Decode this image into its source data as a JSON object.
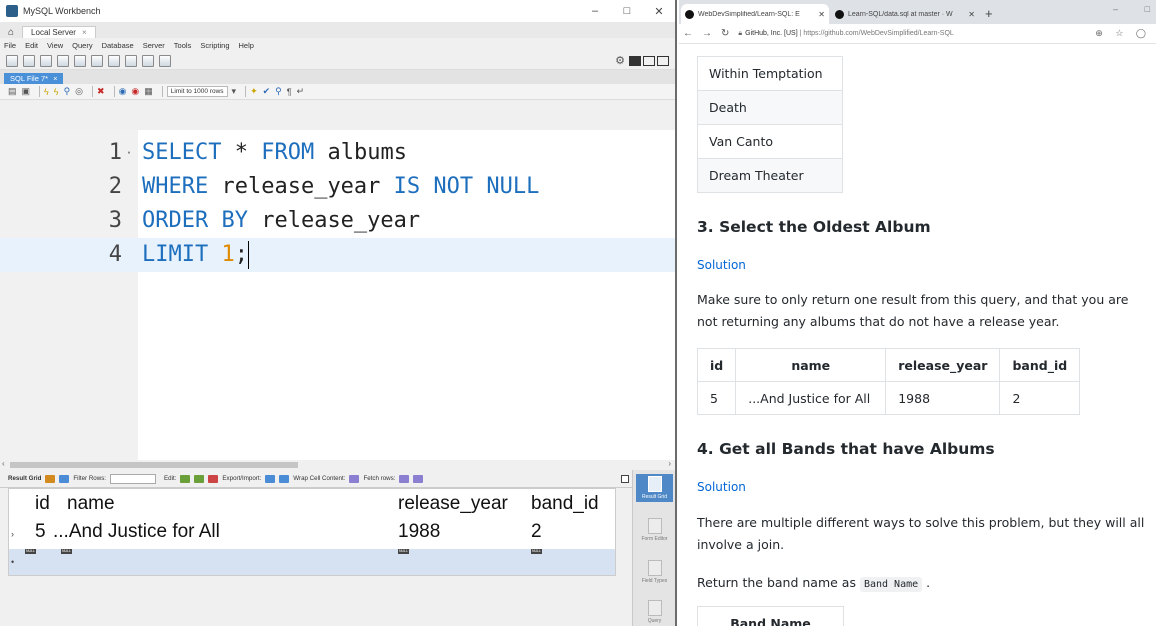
{
  "workbench": {
    "title": "MySQL Workbench",
    "window_controls": [
      "–",
      "□",
      "✕"
    ],
    "connection_tab": "Local Server",
    "menu": [
      "File",
      "Edit",
      "View",
      "Query",
      "Database",
      "Server",
      "Tools",
      "Scripting",
      "Help"
    ],
    "sql_tab": "SQL File 7*",
    "limit_select": "Limit to 1000 rows",
    "code_lines": [
      {
        "num": "1",
        "fold": "·"
      },
      {
        "num": "2",
        "fold": ""
      },
      {
        "num": "3",
        "fold": ""
      },
      {
        "num": "4",
        "fold": ""
      }
    ],
    "code_tokens": {
      "l1_kw1": "SELECT",
      "l1_mid": " * ",
      "l1_kw2": "FROM",
      "l1_rest": " albums",
      "l2_kw1": "WHERE",
      "l2_mid": " release_year ",
      "l2_kw2": "IS NOT NULL",
      "l3_kw1": "ORDER BY",
      "l3_rest": " release_year",
      "l4_kw1": "LIMIT",
      "l4_num": "1",
      "l4_end": ";"
    },
    "result_toolbar": {
      "result_grid": "Result Grid",
      "filter_rows": "Filter Rows:",
      "edit": "Edit:",
      "export_import": "Export/Import:",
      "wrap": "Wrap Cell Content:",
      "fetch_rows": "Fetch rows:"
    },
    "grid": {
      "columns": [
        "id",
        "name",
        "release_year",
        "band_id"
      ],
      "rows": [
        [
          "5",
          "...And Justice for All",
          "1988",
          "2"
        ]
      ],
      "null_label": "NULL"
    },
    "side_panel": [
      "Result Grid",
      "Form Editor",
      "Field Types",
      "Query"
    ]
  },
  "browser": {
    "tabs": [
      {
        "title": "WebDevSimplified/Learn-SQL: E",
        "close": "✕"
      },
      {
        "title": "Learn-SQL/data.sql at master · W",
        "close": "✕"
      }
    ],
    "new_tab": "+",
    "window_controls": [
      "–",
      "□"
    ],
    "url_host": "GitHub, Inc. [US]",
    "url_path": "https://github.com/WebDevSimplified/Learn-SQL"
  },
  "page": {
    "band_rows": [
      "Within Temptation",
      "Death",
      "Van Canto",
      "Dream Theater"
    ],
    "section3_title": "3. Select the Oldest Album",
    "section3_link": "Solution",
    "section3_text_1": "Make sure to only return one result from this query, and that you are",
    "section3_text_2": "not returning any albums that do not have a release year.",
    "result_table": {
      "columns": [
        "id",
        "name",
        "release_year",
        "band_id"
      ],
      "rows": [
        [
          "5",
          "...And Justice for All",
          "1988",
          "2"
        ]
      ]
    },
    "section4_title": "4. Get all Bands that have Albums",
    "section4_link": "Solution",
    "section4_text_1": "There are multiple different ways to solve this problem, but they will all",
    "section4_text_2": "involve a join.",
    "return_text": "Return the band name as",
    "return_code": "Band Name",
    "return_end": ".",
    "bandname_header": "Band Name"
  }
}
